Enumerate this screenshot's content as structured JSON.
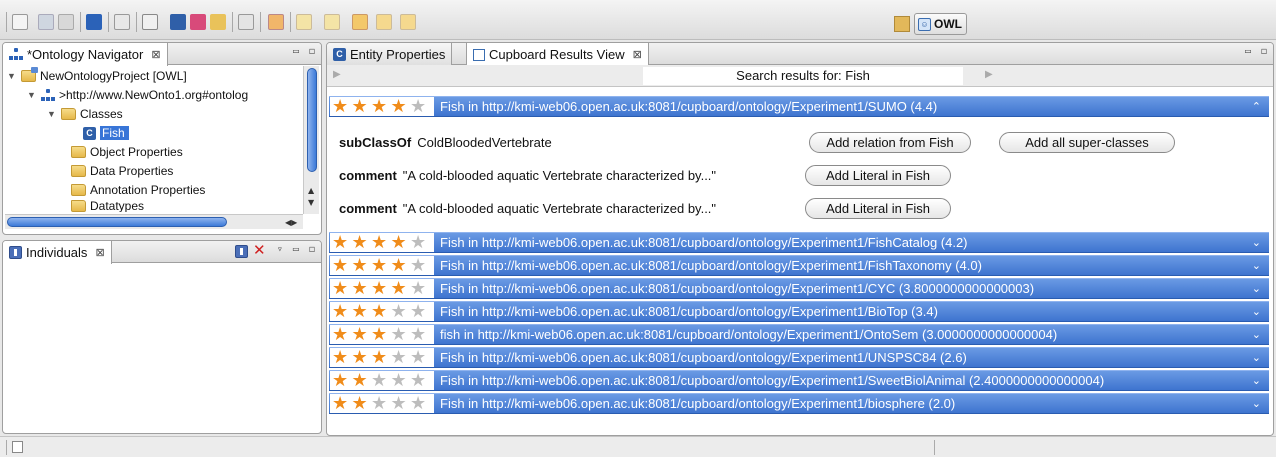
{
  "toolbar": {
    "perspective_label": "OWL"
  },
  "navigator": {
    "tab_label": "*Ontology Navigator",
    "tree": {
      "project": "NewOntologyProject [OWL]",
      "ontology": ">http://www.NewOnto1.org#ontolog",
      "classes": "Classes",
      "selected_class": "Fish",
      "object_properties": "Object Properties",
      "data_properties": "Data Properties",
      "annotation_properties": "Annotation Properties",
      "datatypes": "Datatypes"
    }
  },
  "individuals": {
    "tab_label": "Individuals"
  },
  "results": {
    "tab_entity": "Entity Properties",
    "tab_cupboard": "Cupboard Results View",
    "search_text": "Search results for: Fish",
    "expanded": {
      "text": "Fish in http://kmi-web06.open.ac.uk:8081/cupboard/ontology/Experiment1/SUMO (4.4)",
      "stars": 4,
      "rows": [
        {
          "key": "subClassOf",
          "value": "ColdBloodedVertebrate"
        },
        {
          "key": "comment",
          "value": "\"A cold-blooded aquatic Vertebrate characterized by...\""
        },
        {
          "key": "comment",
          "value": "\"A cold-blooded aquatic Vertebrate characterized by...\""
        }
      ],
      "buttons": {
        "add_relation": "Add relation from Fish",
        "add_super": "Add all super-classes",
        "add_literal": "Add Literal in Fish"
      }
    },
    "items": [
      {
        "text": "Fish in http://kmi-web06.open.ac.uk:8081/cupboard/ontology/Experiment1/FishCatalog (4.2)",
        "stars": 4
      },
      {
        "text": "Fish in http://kmi-web06.open.ac.uk:8081/cupboard/ontology/Experiment1/FishTaxonomy (4.0)",
        "stars": 4
      },
      {
        "text": "Fish in http://kmi-web06.open.ac.uk:8081/cupboard/ontology/Experiment1/CYC (3.8000000000000003)",
        "stars": 4
      },
      {
        "text": "Fish in http://kmi-web06.open.ac.uk:8081/cupboard/ontology/Experiment1/BioTop (3.4)",
        "stars": 3
      },
      {
        "text": "fish in http://kmi-web06.open.ac.uk:8081/cupboard/ontology/Experiment1/OntoSem (3.0000000000000004)",
        "stars": 3
      },
      {
        "text": "Fish in http://kmi-web06.open.ac.uk:8081/cupboard/ontology/Experiment1/UNSPSC84 (2.6)",
        "stars": 3
      },
      {
        "text": "Fish in http://kmi-web06.open.ac.uk:8081/cupboard/ontology/Experiment1/SweetBiolAnimal (2.4000000000000004)",
        "stars": 2
      },
      {
        "text": "Fish in http://kmi-web06.open.ac.uk:8081/cupboard/ontology/Experiment1/biosphere (2.0)",
        "stars": 2
      }
    ]
  },
  "colors": {
    "result_bar": "#4a80d8",
    "star_on": "#f08c1a",
    "selection": "#3875d7"
  }
}
